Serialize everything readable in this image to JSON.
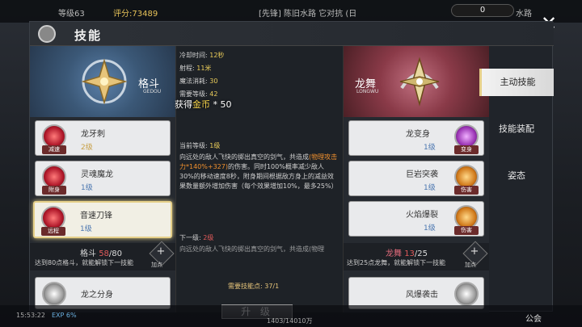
{
  "topbar": {
    "level": "等级63",
    "score": "评分:73489",
    "channel": "[先锋] 陈旧水路 它对抗 (日",
    "gold": "0",
    "location": "水路"
  },
  "header": {
    "title": "技能"
  },
  "left": {
    "hero_name": "格斗",
    "hero_sub": "GEDOU",
    "skills": [
      {
        "name": "龙牙刺",
        "level": "2级",
        "tag": "减速"
      },
      {
        "name": "灵魂魔龙",
        "level": "1级",
        "tag": "附身"
      },
      {
        "name": "音速刀锋",
        "level": "1级",
        "tag": "远程"
      },
      {
        "name": "龙之分身",
        "level": "",
        "tag": ""
      }
    ],
    "progress": {
      "name": "格斗",
      "current": "58",
      "total": "/80",
      "note": "达到80点格斗，就能解锁下一技能",
      "plus": "加点"
    }
  },
  "right": {
    "hero_name": "龙舞",
    "hero_sub": "LONGWU",
    "skills": [
      {
        "name": "龙变身",
        "level": "1级",
        "tag": "变身"
      },
      {
        "name": "巨岩突袭",
        "level": "1级",
        "tag": "伤害"
      },
      {
        "name": "火焰爆裂",
        "level": "1级",
        "tag": "伤害"
      },
      {
        "name": "风爆袭击",
        "level": "",
        "tag": ""
      }
    ],
    "progress": {
      "name": "龙舞",
      "current": "13",
      "total": "/25",
      "note": "达到25点龙舞，就能解锁下一技能",
      "plus": "加点"
    }
  },
  "detail": {
    "cooldown_label": "冷却时间:",
    "cooldown": "12秒",
    "range_label": "射程:",
    "range": "11米",
    "mana_label": "魔法消耗:",
    "mana": "30",
    "req_label": "需要等级:",
    "req": "42",
    "current_label": "当前等级:",
    "current": "1级",
    "desc_a": "向远处的敌人飞快的掷出真空的剑气，共造成",
    "desc_b": "(物理攻击力*140%+327)",
    "desc_c": "的伤害。同时100%概率减少敌人30%的移动速度8秒，附身期间根据敌方身上的减益效果数量额外增加伤害（每个效果增加10%，最多25%）",
    "next_label": "下一级:",
    "next": "2级",
    "next_desc": "向远处的敌人飞快的掷出真空的剑气，共造成(物理",
    "points_label": "需要技能点:",
    "points": "37/1",
    "upgrade": "升 级"
  },
  "float_text": {
    "pre": "获得",
    "gold": "金币",
    "amount": "* 50"
  },
  "tabs": [
    "主动技能",
    "技能装配",
    "姿态"
  ],
  "bottom": {
    "time": "15:53:22",
    "exp": "EXP 6%",
    "counter": "1403/14010万",
    "guild": "公会"
  }
}
